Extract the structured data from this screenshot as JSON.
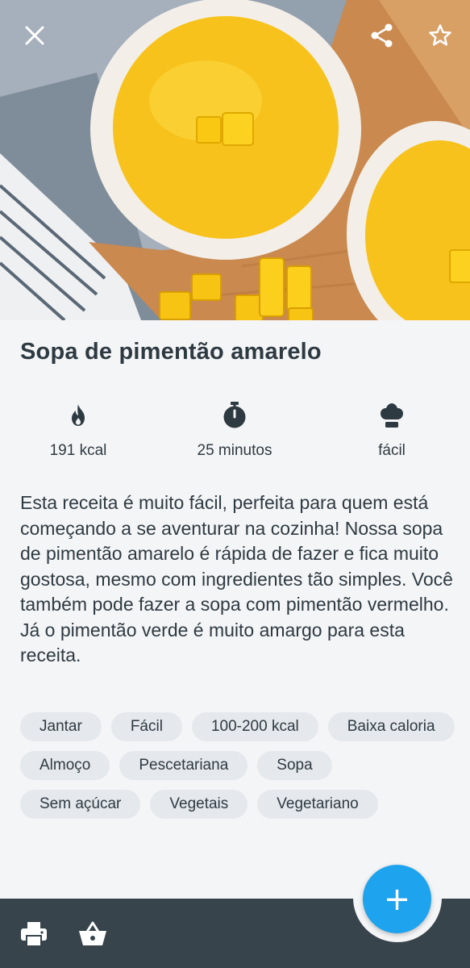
{
  "recipe": {
    "title": "Sopa de pimentão amarelo",
    "stats": {
      "calories": "191 kcal",
      "time": "25 minutos",
      "difficulty": "fácil"
    },
    "description": "Esta receita é muito fácil, perfeita para quem está começando a se aventurar na cozinha! Nossa sopa de pimentão amarelo é rápida de fazer e fica muito gostosa, mesmo com ingredientes tão simples. Você também pode fazer a sopa com pimentão vermelho. Já o pimentão verde é muito amargo para esta receita.",
    "tags": [
      "Jantar",
      "Fácil",
      "100-200 kcal",
      "Baixa caloria",
      "Almoço",
      "Pescetariana",
      "Sopa",
      "Sem açúcar",
      "Vegetais",
      "Vegetariano"
    ]
  },
  "header": {
    "icons": [
      "close-icon",
      "share-icon",
      "star-icon"
    ]
  },
  "bottom_bar": {
    "icons": [
      "print-icon",
      "basket-icon"
    ],
    "fab_symbol": "+"
  },
  "colors": {
    "text": "#2e3a42",
    "background": "#f4f5f7",
    "tag_background": "#e5e8ec",
    "bottom_bar": "#37444c",
    "fab": "#1ea3ee",
    "soup": "#f7c21b"
  }
}
